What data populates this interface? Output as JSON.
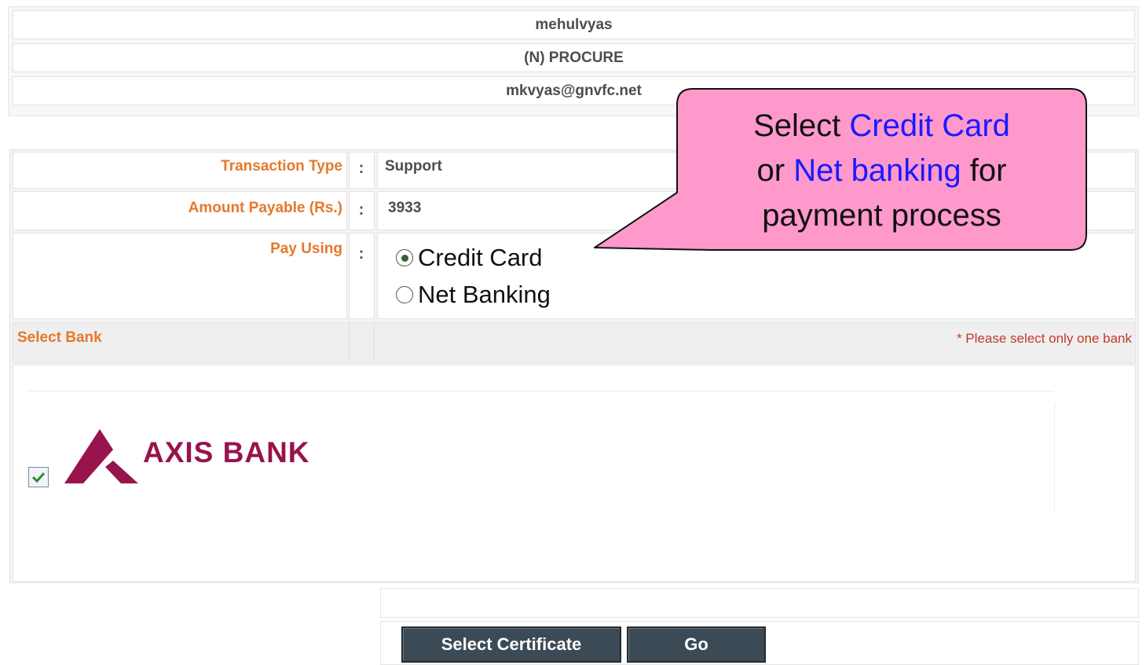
{
  "user": {
    "name": "mehulvyas",
    "department": "(N) PROCURE",
    "email": "mkvyas@gnvfc.net"
  },
  "transaction": {
    "type_label": "Transaction Type",
    "type_value": "Support",
    "amount_label": "Amount Payable (Rs.)",
    "amount_value": "3933",
    "pay_using_label": "Pay Using",
    "separator": ":",
    "options": [
      {
        "label": "Credit Card",
        "selected": true
      },
      {
        "label": "Net Banking",
        "selected": false
      }
    ]
  },
  "bank": {
    "section_label": "Select Bank",
    "note": "* Please select only one bank",
    "bank_name": "AXIS BANK",
    "checked": true,
    "brand_color": "#97144d"
  },
  "buttons": {
    "select_certificate": "Select Certificate",
    "go": "Go"
  },
  "callout": {
    "part1": "Select ",
    "link1": "Credit Card",
    "part2": "or ",
    "link2": "Net banking",
    "part3": " for",
    "part4": "payment process",
    "fill": "#ff99cc",
    "highlight": "#1a1aff"
  }
}
